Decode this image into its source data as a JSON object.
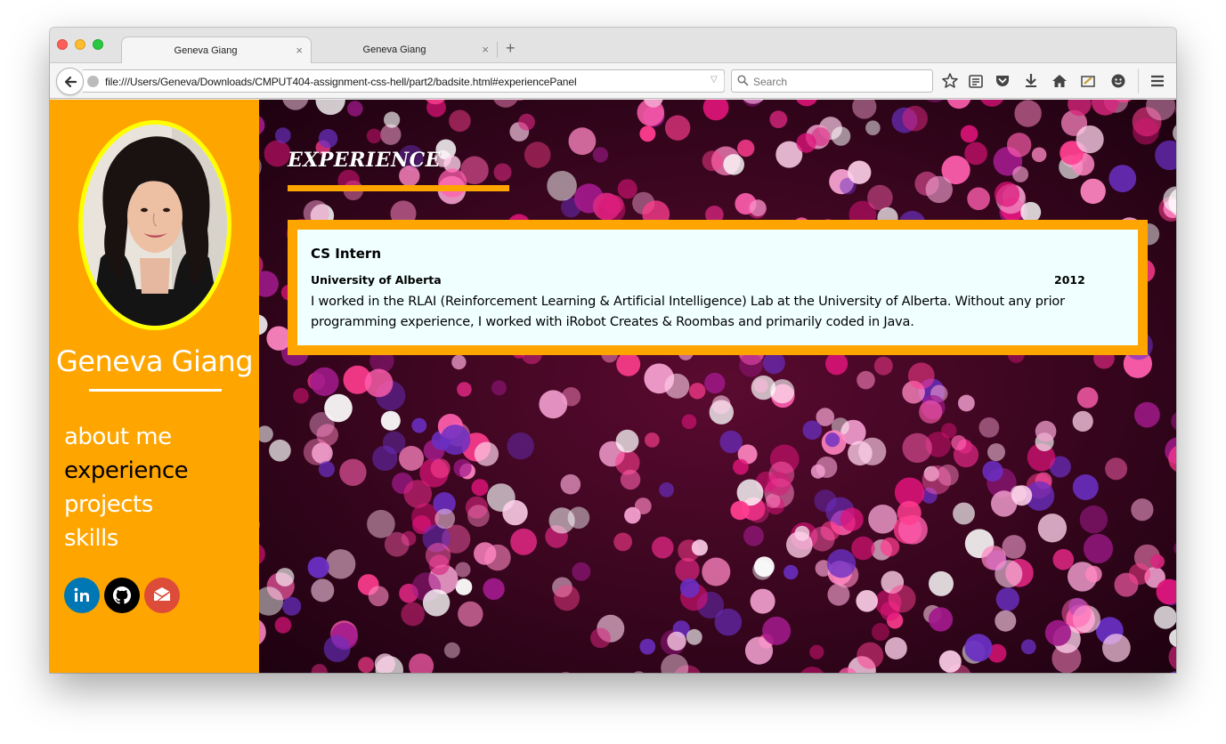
{
  "browser": {
    "tabs": [
      {
        "title": "Geneva Giang",
        "active": true,
        "close": "×"
      },
      {
        "title": "Geneva Giang",
        "active": false,
        "close": "×"
      }
    ],
    "new_tab": "+",
    "url": "file:///Users/Geneva/Downloads/CMPUT404-assignment-css-hell/part2/badsite.html#experiencePanel",
    "search_placeholder": "Search",
    "toolbar_icons": [
      "bookmark-star-icon",
      "reading-list-icon",
      "pocket-icon",
      "download-icon",
      "home-icon",
      "screenshot-icon",
      "emoji-icon",
      "hamburger-menu-icon"
    ]
  },
  "profile": {
    "name": "Geneva Giang",
    "photo_alt": "Profile photo"
  },
  "nav": [
    {
      "label": "about me",
      "active": false
    },
    {
      "label": "experience",
      "active": true
    },
    {
      "label": "projects",
      "active": false
    },
    {
      "label": "skills",
      "active": false
    }
  ],
  "socials": [
    {
      "name": "linkedin-icon",
      "color": "#0077b5"
    },
    {
      "name": "github-icon",
      "color": "#000000"
    },
    {
      "name": "mail-icon",
      "color": "#dd4b39"
    }
  ],
  "section": {
    "title": "EXPERIENCE"
  },
  "experience": [
    {
      "role": "CS Intern",
      "organization": "University of Alberta",
      "year": "2012",
      "description": "I worked in the RLAI (Reinforcement Learning & Artificial Intelligence) Lab at the University of Alberta. Without any prior programming experience, I worked with iRobot Creates & Roombas and primarily coded in Java."
    }
  ],
  "colors": {
    "sidebar": "#ffa500",
    "avatar_border": "#ffff00",
    "card_bg": "#f0ffff",
    "card_border": "#ffa500"
  }
}
